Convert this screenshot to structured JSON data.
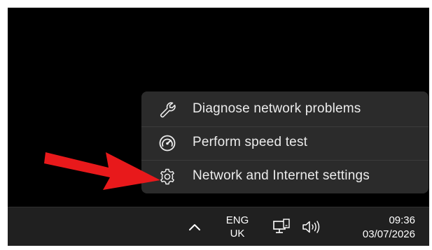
{
  "menu": {
    "items": [
      {
        "label": "Diagnose network problems",
        "icon": "wrench-icon"
      },
      {
        "label": "Perform speed test",
        "icon": "speedometer-icon"
      },
      {
        "label": "Network and Internet settings",
        "icon": "gear-icon"
      }
    ]
  },
  "taskbar": {
    "language_line1": "ENG",
    "language_line2": "UK",
    "time": "09:36",
    "date": "03/07/2026"
  },
  "colors": {
    "annotation_arrow": "#e8191b",
    "menu_background": "#2b2b2b",
    "taskbar_background": "#202020"
  }
}
